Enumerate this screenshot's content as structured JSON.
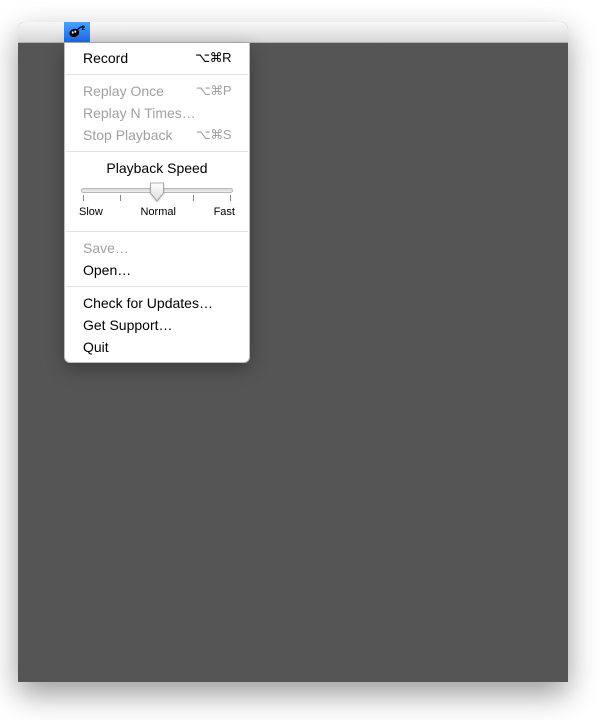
{
  "menu": {
    "record": {
      "label": "Record",
      "shortcut": "⌥⌘R"
    },
    "replay_once": {
      "label": "Replay Once",
      "shortcut": "⌥⌘P"
    },
    "replay_n": {
      "label": "Replay N Times…",
      "shortcut": ""
    },
    "stop_playback": {
      "label": "Stop Playback",
      "shortcut": "⌥⌘S"
    },
    "playback_speed": {
      "title": "Playback Speed",
      "labels": {
        "slow": "Slow",
        "normal": "Normal",
        "fast": "Fast"
      },
      "value": 0.5
    },
    "save": {
      "label": "Save…"
    },
    "open": {
      "label": "Open…"
    },
    "check_updates": {
      "label": "Check for Updates…"
    },
    "get_support": {
      "label": "Get Support…"
    },
    "quit": {
      "label": "Quit"
    }
  }
}
